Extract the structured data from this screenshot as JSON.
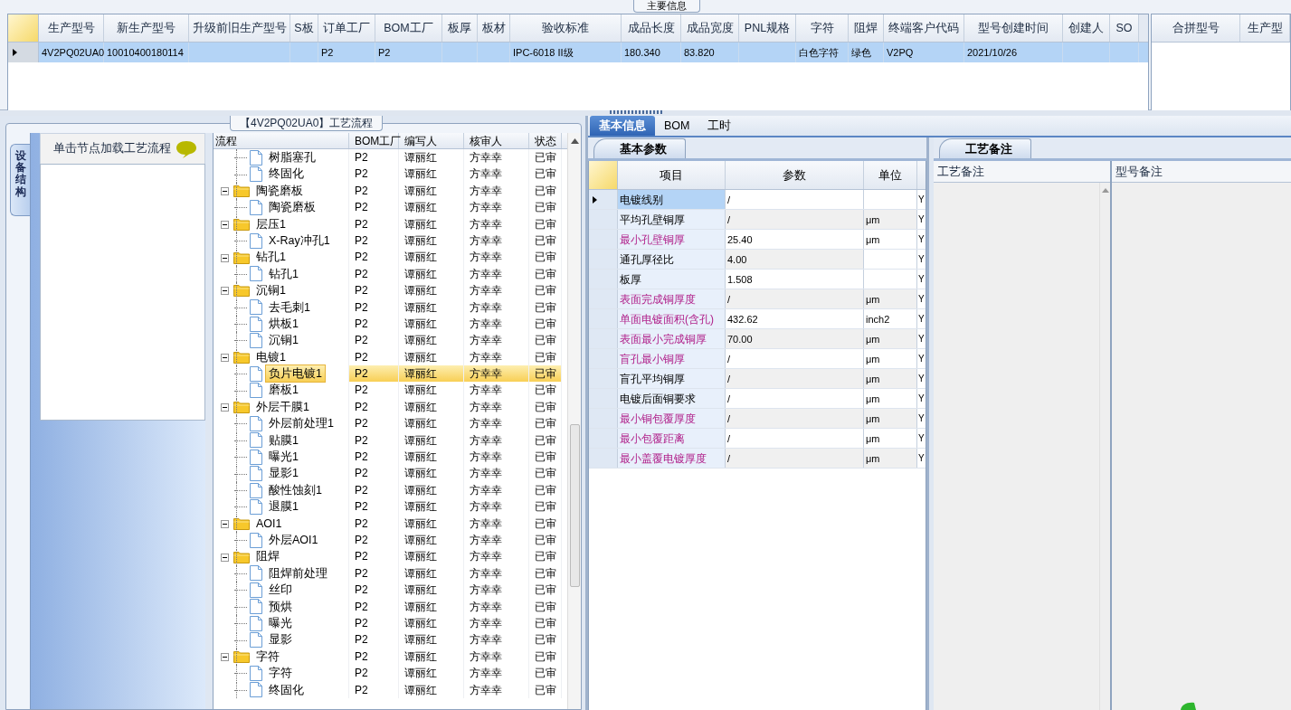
{
  "main_info": {
    "title": "主要信息",
    "columns": [
      "生产型号",
      "新生产型号",
      "升级前旧生产型号",
      "S板",
      "订单工厂",
      "BOM工厂",
      "板厚",
      "板材",
      "验收标准",
      "成品长度",
      "成品宽度",
      "PNL规格",
      "字符",
      "阻焊",
      "终端客户代码",
      "型号创建时间",
      "创建人",
      "SO"
    ],
    "rows": [
      {
        "selected": true,
        "cells": [
          "4V2PQ02UA0",
          "10010400180114",
          "",
          "",
          "P2",
          "P2",
          "",
          "",
          "IPC-6018 II级",
          "180.340",
          "83.820",
          "",
          "白色字符",
          "绿色",
          "V2PQ",
          "2021/10/26",
          "",
          ""
        ]
      }
    ],
    "side_columns": [
      "合拼型号",
      "生产型"
    ]
  },
  "process": {
    "title": "【4V2PQ02UA0】工艺流程",
    "side_tab": "设备结构",
    "hint": "单击节点加载工艺流程",
    "columns": [
      "流程",
      "BOM工厂",
      "编写人",
      "核审人",
      "状态"
    ],
    "tree": [
      {
        "children": [
          {
            "kind": "file",
            "label": "树脂塞孔",
            "bom": "P2",
            "writer": "谭丽红",
            "reviewer": "方幸幸",
            "status": "已审",
            "selected": false
          },
          {
            "kind": "file",
            "label": "终固化",
            "bom": "P2",
            "writer": "谭丽红",
            "reviewer": "方幸幸",
            "status": "已审",
            "selected": false
          }
        ]
      },
      {
        "kind": "folder",
        "label": "陶瓷磨板",
        "bom": "P2",
        "writer": "谭丽红",
        "reviewer": "方幸幸",
        "status": "已审",
        "selected": false,
        "expanded": true,
        "children": [
          {
            "kind": "file",
            "label": "陶瓷磨板",
            "bom": "P2",
            "writer": "谭丽红",
            "reviewer": "方幸幸",
            "status": "已审",
            "selected": false
          }
        ]
      },
      {
        "kind": "folder",
        "label": "层压1",
        "bom": "P2",
        "writer": "谭丽红",
        "reviewer": "方幸幸",
        "status": "已审",
        "selected": false,
        "expanded": true,
        "children": [
          {
            "kind": "file",
            "label": "X-Ray冲孔1",
            "bom": "P2",
            "writer": "谭丽红",
            "reviewer": "方幸幸",
            "status": "已审",
            "selected": false
          }
        ]
      },
      {
        "kind": "folder",
        "label": "钻孔1",
        "bom": "P2",
        "writer": "谭丽红",
        "reviewer": "方幸幸",
        "status": "已审",
        "selected": false,
        "expanded": true,
        "children": [
          {
            "kind": "file",
            "label": "钻孔1",
            "bom": "P2",
            "writer": "谭丽红",
            "reviewer": "方幸幸",
            "status": "已审",
            "selected": false
          }
        ]
      },
      {
        "kind": "folder",
        "label": "沉铜1",
        "bom": "P2",
        "writer": "谭丽红",
        "reviewer": "方幸幸",
        "status": "已审",
        "selected": false,
        "expanded": true,
        "children": [
          {
            "kind": "file",
            "label": "去毛刺1",
            "bom": "P2",
            "writer": "谭丽红",
            "reviewer": "方幸幸",
            "status": "已审",
            "selected": false
          },
          {
            "kind": "file",
            "label": "烘板1",
            "bom": "P2",
            "writer": "谭丽红",
            "reviewer": "方幸幸",
            "status": "已审",
            "selected": false
          },
          {
            "kind": "file",
            "label": "沉铜1",
            "bom": "P2",
            "writer": "谭丽红",
            "reviewer": "方幸幸",
            "status": "已审",
            "selected": false
          }
        ]
      },
      {
        "kind": "folder",
        "label": "电镀1",
        "bom": "P2",
        "writer": "谭丽红",
        "reviewer": "方幸幸",
        "status": "已审",
        "selected": false,
        "expanded": true,
        "children": [
          {
            "kind": "file",
            "label": "负片电镀1",
            "bom": "P2",
            "writer": "谭丽红",
            "reviewer": "方幸幸",
            "status": "已审",
            "selected": true
          },
          {
            "kind": "file",
            "label": "磨板1",
            "bom": "P2",
            "writer": "谭丽红",
            "reviewer": "方幸幸",
            "status": "已审",
            "selected": false
          }
        ]
      },
      {
        "kind": "folder",
        "label": "外层干膜1",
        "bom": "P2",
        "writer": "谭丽红",
        "reviewer": "方幸幸",
        "status": "已审",
        "selected": false,
        "expanded": true,
        "children": [
          {
            "kind": "file",
            "label": "外层前处理1",
            "bom": "P2",
            "writer": "谭丽红",
            "reviewer": "方幸幸",
            "status": "已审",
            "selected": false
          },
          {
            "kind": "file",
            "label": "贴膜1",
            "bom": "P2",
            "writer": "谭丽红",
            "reviewer": "方幸幸",
            "status": "已审",
            "selected": false
          },
          {
            "kind": "file",
            "label": "曝光1",
            "bom": "P2",
            "writer": "谭丽红",
            "reviewer": "方幸幸",
            "status": "已审",
            "selected": false
          },
          {
            "kind": "file",
            "label": "显影1",
            "bom": "P2",
            "writer": "谭丽红",
            "reviewer": "方幸幸",
            "status": "已审",
            "selected": false
          },
          {
            "kind": "file",
            "label": "酸性蚀刻1",
            "bom": "P2",
            "writer": "谭丽红",
            "reviewer": "方幸幸",
            "status": "已审",
            "selected": false
          },
          {
            "kind": "file",
            "label": "退膜1",
            "bom": "P2",
            "writer": "谭丽红",
            "reviewer": "方幸幸",
            "status": "已审",
            "selected": false
          }
        ]
      },
      {
        "kind": "folder",
        "label": "AOI1",
        "bom": "P2",
        "writer": "谭丽红",
        "reviewer": "方幸幸",
        "status": "已审",
        "selected": false,
        "expanded": true,
        "children": [
          {
            "kind": "file",
            "label": "外层AOI1",
            "bom": "P2",
            "writer": "谭丽红",
            "reviewer": "方幸幸",
            "status": "已审",
            "selected": false
          }
        ]
      },
      {
        "kind": "folder",
        "label": "阻焊",
        "bom": "P2",
        "writer": "谭丽红",
        "reviewer": "方幸幸",
        "status": "已审",
        "selected": false,
        "expanded": true,
        "children": [
          {
            "kind": "file",
            "label": "阻焊前处理",
            "bom": "P2",
            "writer": "谭丽红",
            "reviewer": "方幸幸",
            "status": "已审",
            "selected": false
          },
          {
            "kind": "file",
            "label": "丝印",
            "bom": "P2",
            "writer": "谭丽红",
            "reviewer": "方幸幸",
            "status": "已审",
            "selected": false
          },
          {
            "kind": "file",
            "label": "预烘",
            "bom": "P2",
            "writer": "谭丽红",
            "reviewer": "方幸幸",
            "status": "已审",
            "selected": false
          },
          {
            "kind": "file",
            "label": "曝光",
            "bom": "P2",
            "writer": "谭丽红",
            "reviewer": "方幸幸",
            "status": "已审",
            "selected": false
          },
          {
            "kind": "file",
            "label": "显影",
            "bom": "P2",
            "writer": "谭丽红",
            "reviewer": "方幸幸",
            "status": "已审",
            "selected": false
          }
        ]
      },
      {
        "kind": "folder",
        "label": "字符",
        "bom": "P2",
        "writer": "谭丽红",
        "reviewer": "方幸幸",
        "status": "已审",
        "selected": false,
        "expanded": true,
        "children": [
          {
            "kind": "file",
            "label": "字符",
            "bom": "P2",
            "writer": "谭丽红",
            "reviewer": "方幸幸",
            "status": "已审",
            "selected": false
          },
          {
            "kind": "file",
            "label": "终固化",
            "bom": "P2",
            "writer": "谭丽红",
            "reviewer": "方幸幸",
            "status": "已审",
            "selected": false
          }
        ]
      }
    ]
  },
  "detail_tabs": [
    {
      "label": "基本信息",
      "selected": true
    },
    {
      "label": "BOM",
      "selected": false
    },
    {
      "label": "工时",
      "selected": false
    }
  ],
  "params": {
    "tab": "基本参数",
    "columns": [
      "项目",
      "参数",
      "单位"
    ],
    "rows": [
      {
        "name": "电镀线别",
        "value": "/",
        "unit": "",
        "flag": "Y",
        "highlighted": false,
        "selected": true
      },
      {
        "name": "平均孔壁铜厚",
        "value": "/",
        "unit": "μm",
        "flag": "Y",
        "highlighted": false,
        "selected": false
      },
      {
        "name": "最小孔壁铜厚",
        "value": "25.40",
        "unit": "μm",
        "flag": "Y",
        "highlighted": true,
        "selected": false
      },
      {
        "name": "通孔厚径比",
        "value": "4.00",
        "unit": "",
        "flag": "Y",
        "highlighted": false,
        "selected": false
      },
      {
        "name": "板厚",
        "value": "1.508",
        "unit": "",
        "flag": "Y",
        "highlighted": false,
        "selected": false
      },
      {
        "name": "表面完成铜厚度",
        "value": "/",
        "unit": "μm",
        "flag": "Y",
        "highlighted": true,
        "selected": false
      },
      {
        "name": "单面电镀面积(含孔)",
        "value": "432.62",
        "unit": "inch2",
        "flag": "Y",
        "highlighted": true,
        "selected": false
      },
      {
        "name": "表面最小完成铜厚",
        "value": "70.00",
        "unit": "μm",
        "flag": "Y",
        "highlighted": true,
        "selected": false
      },
      {
        "name": "盲孔最小铜厚",
        "value": "/",
        "unit": "μm",
        "flag": "Y",
        "highlighted": true,
        "selected": false
      },
      {
        "name": "盲孔平均铜厚",
        "value": "/",
        "unit": "μm",
        "flag": "Y",
        "highlighted": false,
        "selected": false
      },
      {
        "name": "电镀后面铜要求",
        "value": "/",
        "unit": "μm",
        "flag": "Y",
        "highlighted": false,
        "selected": false
      },
      {
        "name": "最小铜包覆厚度",
        "value": "/",
        "unit": "μm",
        "flag": "Y",
        "highlighted": true,
        "selected": false
      },
      {
        "name": "最小包覆距离",
        "value": "/",
        "unit": "μm",
        "flag": "Y",
        "highlighted": true,
        "selected": false
      },
      {
        "name": "最小盖覆电镀厚度",
        "value": "/",
        "unit": "μm",
        "flag": "Y",
        "highlighted": true,
        "selected": false
      }
    ]
  },
  "notes": {
    "tab": "工艺备注",
    "columns": [
      "工艺备注",
      "型号备注"
    ]
  }
}
